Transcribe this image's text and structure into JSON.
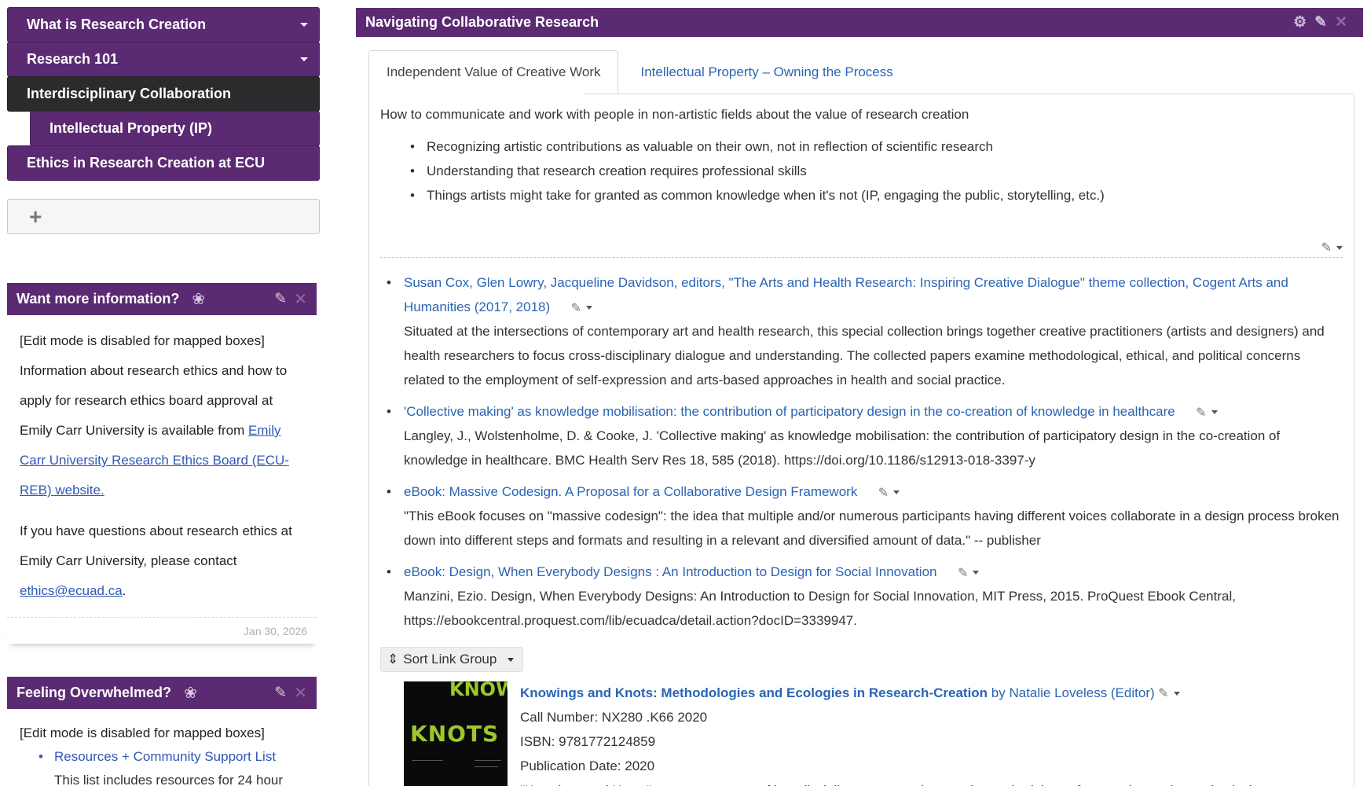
{
  "nav": {
    "items": [
      {
        "label": "What is Research Creation",
        "dropdown": true
      },
      {
        "label": "Research 101",
        "dropdown": true
      },
      {
        "label": "Interdisciplinary Collaboration",
        "active": true
      },
      {
        "label": "Intellectual Property (IP)"
      },
      {
        "label": "Ethics in Research Creation at ECU"
      }
    ],
    "add_label": "+"
  },
  "box1": {
    "title": "Want more information?",
    "edit_note": "[Edit mode is disabled for mapped boxes]",
    "p1_text": "Information about research ethics and how to apply for research ethics board approval at Emily Carr University is available from ",
    "p1_link": "Emily Carr University Research Ethics Board (ECU-REB) website.",
    "p2_text": "If you have questions about research ethics at Emily Carr University, please contact ",
    "p2_link": "ethics@ecuad.ca",
    "p2_end": ".",
    "date": "Jan 30, 2026"
  },
  "box2": {
    "title": "Feeling Overwhelmed?",
    "edit_note": "[Edit mode is disabled for mapped boxes]",
    "link": "Resources + Community Support List",
    "sub": "This list includes resources for 24 hour"
  },
  "main": {
    "title": "Navigating Collaborative Research",
    "tabs": [
      {
        "label": "Independent Value of Creative Work",
        "active": true
      },
      {
        "label": "Intellectual Property – Owning the Process"
      }
    ],
    "intro": "How to communicate and work with people in non-artistic fields about the value of research creation",
    "bullets": [
      "Recognizing artistic contributions as valuable on their own, not in reflection of scientific research",
      "Understanding that research creation requires professional skills",
      "Things artists might take for granted as common knowledge when it's not (IP, engaging  the public, storytelling, etc.)"
    ],
    "links": [
      {
        "title": "Susan Cox, Glen Lowry, Jacqueline Davidson, editors, \"The Arts and Health Research: Inspiring Creative Dialogue\" theme collection, Cogent Arts and Humanities (2017, 2018)",
        "desc": "Situated at the intersections of contemporary art and health research, this special collection brings together creative practitioners (artists and designers) and health researchers to focus cross-disciplinary dialogue and understanding. The collected papers examine methodological, ethical, and political concerns related to the employment of self-expression and arts-based approaches in health and social practice."
      },
      {
        "title": "'Collective making' as knowledge mobilisation: the contribution of participatory design in the co-creation of knowledge in healthcare",
        "desc": "Langley, J., Wolstenholme, D. & Cooke, J. 'Collective making' as knowledge mobilisation: the contribution of participatory design in the co-creation of knowledge in healthcare. BMC Health Serv Res 18, 585 (2018). https://doi.org/10.1186/s12913-018-3397-y"
      },
      {
        "title": "eBook: Massive Codesign. A Proposal for a Collaborative Design Framework",
        "desc": "\"This eBook focuses on \"massive codesign\": the idea that multiple and/or numerous participants having different voices collaborate in a design process broken down into different steps and formats and resulting in a relevant and diversified amount of data.\" -- publisher"
      },
      {
        "title": "eBook: Design, When Everybody Designs : An Introduction to Design for Social Innovation",
        "desc": "Manzini, Ezio. Design, When Everybody Designs: An Introduction to Design for Social Innovation, MIT Press, 2015. ProQuest Ebook Central, https://ebookcentral.proquest.com/lib/ecuadca/detail.action?docID=3339947."
      }
    ],
    "sort_label": "Sort Link Group",
    "book": {
      "title": "Knowings and Knots: Methodologies and Ecologies in Research-Creation",
      "by": " by Natalie Loveless (Editor)",
      "call_number": "Call Number: NX280 .K66 2020",
      "isbn": "ISBN: 9781772124859",
      "pub_date": "Publication Date: 2020",
      "desc": "\"Knowings and Knots\" presents a range of interdisciplinary perspectives on the methodology of research-creation and asks how",
      "cover_word": "KNOTS",
      "cover_vertical": "KNOWIN"
    }
  }
}
